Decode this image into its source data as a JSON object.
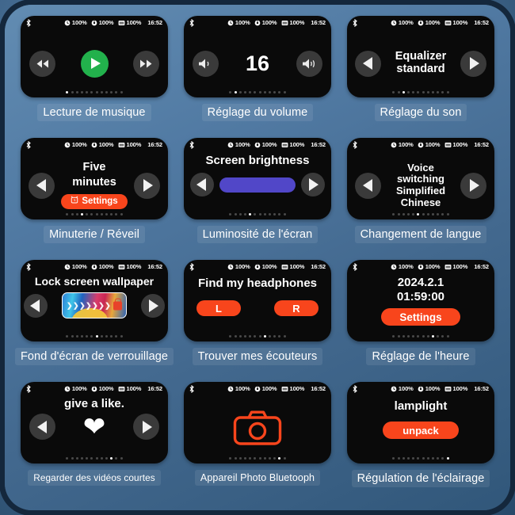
{
  "status_bar": {
    "bluetooth_icon": "bluetooth-icon",
    "left_battery_icon": "left-earbud-battery-icon",
    "left_battery_value": "100%",
    "right_battery_icon": "right-earbud-battery-icon",
    "right_battery_value": "100%",
    "case_battery_icon": "case-battery-icon",
    "case_battery_value": "100%",
    "time": "16:52"
  },
  "colors": {
    "accent_orange": "#f8451c",
    "accent_green": "#22b14c",
    "accent_purple": "#5147c8",
    "screen_black": "#0a0a0a",
    "panel_blue": "#4d7499"
  },
  "dots": {
    "total": 12
  },
  "cards": [
    {
      "id": "music-playback",
      "caption": "Lecture de musique",
      "caption_size": "normal",
      "active_dot": 0,
      "controls": {
        "prev_icon": "rewind-icon",
        "play_icon": "play-icon",
        "next_icon": "fast-forward-icon"
      }
    },
    {
      "id": "volume-adjust",
      "caption": "Réglage du volume",
      "caption_size": "normal",
      "active_dot": 1,
      "value": "16",
      "controls": {
        "down_icon": "volume-down-icon",
        "up_icon": "volume-up-icon"
      }
    },
    {
      "id": "sound-adjust",
      "caption": "Réglage du son",
      "caption_size": "normal",
      "active_dot": 2,
      "line1": "Equalizer",
      "line2": "standard",
      "controls": {
        "prev_icon": "chevron-left-icon",
        "next_icon": "chevron-right-icon"
      }
    },
    {
      "id": "timer-alarm",
      "caption": "Minuterie / Réveil",
      "caption_size": "normal",
      "active_dot": 3,
      "line1": "Five",
      "line2": "minutes",
      "button_label": "Settings",
      "button_icon": "alarm-clock-icon",
      "controls": {
        "prev_icon": "chevron-left-icon",
        "next_icon": "chevron-right-icon"
      }
    },
    {
      "id": "screen-brightness",
      "caption": "Luminosité de l'écran",
      "caption_size": "normal",
      "active_dot": 4,
      "title": "Screen brightness",
      "slider_icon": "brightness-slider",
      "controls": {
        "prev_icon": "chevron-left-icon",
        "next_icon": "chevron-right-icon"
      }
    },
    {
      "id": "language-switch",
      "caption": "Changement de langue",
      "caption_size": "normal",
      "active_dot": 5,
      "line1": "Voice",
      "line2": "switching",
      "line3": "Simplified",
      "line4": "Chinese",
      "controls": {
        "prev_icon": "chevron-left-icon",
        "next_icon": "chevron-right-icon"
      }
    },
    {
      "id": "lock-screen-wallpaper",
      "caption": "Fond d'écran de verrouillage",
      "caption_size": "normal",
      "active_dot": 6,
      "title": "Lock screen wallpaper",
      "thumbnail_icon": "wallpaper-thumbnail",
      "thumbnail_chevrons": "❯❯❯❯❯❯❯",
      "thumbnail_lock_icon": "lock-icon",
      "controls": {
        "prev_icon": "chevron-left-icon",
        "next_icon": "chevron-right-icon"
      }
    },
    {
      "id": "find-headphones",
      "caption": "Trouver mes écouteurs",
      "caption_size": "normal",
      "active_dot": 7,
      "title": "Find my headphones",
      "left_button": "L",
      "right_button": "R"
    },
    {
      "id": "time-setting",
      "caption": "Réglage de l'heure",
      "caption_size": "normal",
      "active_dot": 8,
      "date": "2024.2.1",
      "time": "01:59:00",
      "button_label": "Settings"
    },
    {
      "id": "short-videos",
      "caption": "Regarder des vidéos courtes",
      "caption_size": "xs",
      "active_dot": 9,
      "title": "give a like.",
      "heart_icon": "heart-icon",
      "controls": {
        "prev_icon": "chevron-left-icon",
        "next_icon": "chevron-right-icon"
      }
    },
    {
      "id": "bluetooth-camera",
      "caption": "Appareil Photo Bluetooph",
      "caption_size": "sm",
      "active_dot": 10,
      "camera_icon": "camera-icon"
    },
    {
      "id": "lighting-control",
      "caption": "Régulation de l'éclairage",
      "caption_size": "normal",
      "active_dot": 11,
      "title": "lamplight",
      "button_label": "unpack"
    }
  ]
}
